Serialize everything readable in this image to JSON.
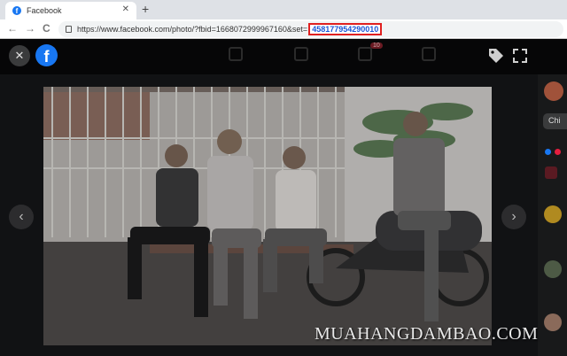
{
  "browser": {
    "tab_title": "Facebook",
    "tab_favicon": "f",
    "tab_close": "✕",
    "new_tab": "+",
    "url_prefix": "https://www.facebook.com/photo/?fbid=1668072999967160&set=",
    "url_highlight": "458177954290010",
    "back_icon": "←",
    "forward_icon": "→",
    "reload_icon": "C"
  },
  "viewer": {
    "close_icon": "✕",
    "logo_letter": "f",
    "notification_badge": "10",
    "prev_icon": "‹",
    "next_icon": "›",
    "tag_icon": "tag-icon",
    "fullscreen_icon": "expand-icon"
  },
  "sidebar": {
    "text": "Chi"
  },
  "watermark": "MUAHANGDAMBAO.COM",
  "colors": {
    "brand": "#1877f2",
    "highlight_border": "#e02020",
    "notification": "#e41e3f"
  }
}
